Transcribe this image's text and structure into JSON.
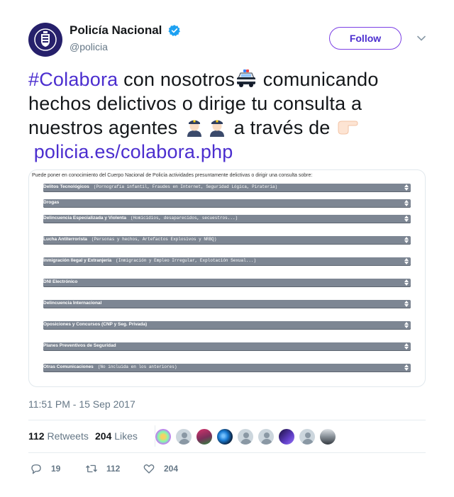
{
  "account": {
    "display_name": "Policía Nacional",
    "handle": "@policia",
    "verified_icon": "verified-badge-icon",
    "follow_label": "Follow",
    "colors": {
      "brand": "#26206b",
      "link": "#4b2ecf",
      "verified": "#1da1f2"
    }
  },
  "tweet": {
    "hashtag": "#Colabora",
    "text_1": " con nosotros",
    "emoji_1": "police-car-icon",
    "text_2": " comunicando hechos delictivos o dirige tu consulta a nuestros agentes ",
    "emoji_2": "police-officer-icon",
    "emoji_3": "police-officer-icon",
    "text_3": " a través de ",
    "emoji_4": "pointing-right-hand-icon",
    "link": "policia.es/colabora.php"
  },
  "media": {
    "header": "Puede poner en conocimiento del Cuerpo Nacional de Policía actividades presuntamente delictivas o dirigir una consulta sobre:",
    "options": [
      {
        "label": "Delitos Tecnológicos",
        "sub": "(Pornografía infantil, Fraudes en Internet, Seguridad Lógica, Piratería)",
        "arrow": "down"
      },
      {
        "label": "Drogas",
        "sub": "",
        "arrow": "down"
      },
      {
        "label": "Delincuencia Especializada y Violenta",
        "sub": "(Homicidios, desaparecidos, secuestros...)",
        "arrow": "down"
      },
      {
        "label": "Lucha Antiterrorista",
        "sub": "(Personas y hechos, Artefactos Explosivos y NRBQ)",
        "arrow": "down"
      },
      {
        "label": "Inmigración Ilegal y Extranjería",
        "sub": "(Inmigración y Empleo Irregular, Explotación Sexual...)",
        "arrow": "down"
      },
      {
        "label": "DNI Electrónico",
        "sub": "",
        "arrow": "down"
      },
      {
        "label": "Delincuencia Internacional",
        "sub": "",
        "arrow": "down"
      },
      {
        "label": "Oposiciones y Concursos (CNP y Seg. Privada)",
        "sub": "",
        "arrow": "down"
      },
      {
        "label": "Planes Preventivos de Seguridad",
        "sub": "",
        "arrow": "down"
      },
      {
        "label": "Otras Comunicaciones",
        "sub": "(No incluida en los anteriores)",
        "arrow": "down"
      }
    ]
  },
  "timestamp": "11:51 PM - 15 Sep 2017",
  "stats": {
    "retweets_count": "112",
    "retweets_label": "Retweets",
    "likes_count": "204",
    "likes_label": "Likes"
  },
  "likers": [
    "colorful-avatar",
    "default-egg-avatar",
    "pink-avatar",
    "blue-avatar",
    "default-egg-avatar",
    "default-egg-avatar",
    "purple-avatar",
    "default-egg-avatar",
    "landscape-avatar"
  ],
  "actions": {
    "reply_count": "19",
    "retweet_count": "112",
    "like_count": "204"
  }
}
